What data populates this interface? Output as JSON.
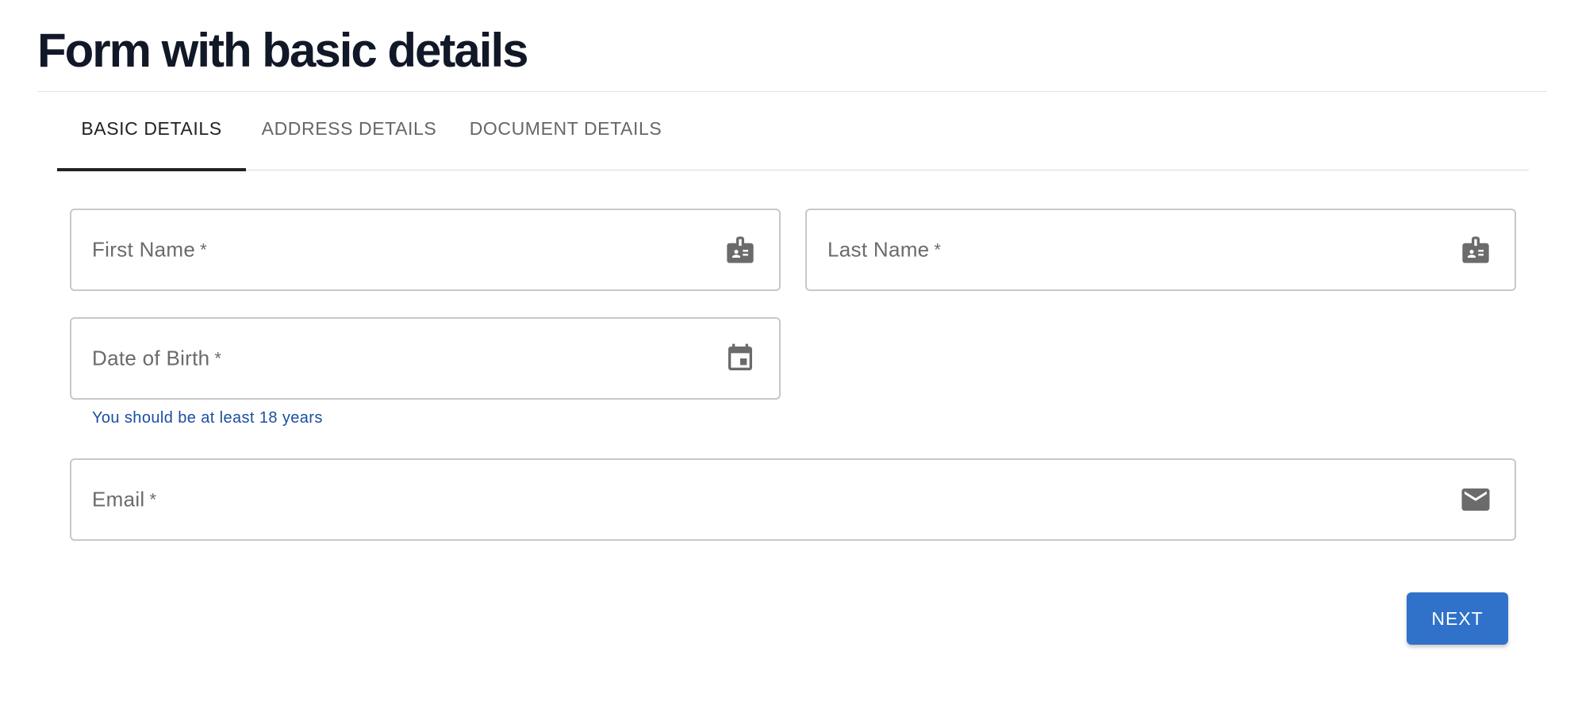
{
  "page": {
    "title": "Form with basic details"
  },
  "tabs": [
    {
      "label": "BASIC DETAILS",
      "active": true
    },
    {
      "label": "ADDRESS DETAILS",
      "active": false
    },
    {
      "label": "DOCUMENT DETAILS",
      "active": false
    }
  ],
  "form": {
    "first_name": {
      "label": "First Name",
      "required_mark": "*",
      "value": "",
      "icon": "badge-icon"
    },
    "last_name": {
      "label": "Last Name",
      "required_mark": "*",
      "value": "",
      "icon": "badge-icon"
    },
    "date_of_birth": {
      "label": "Date of Birth",
      "required_mark": "*",
      "value": "",
      "icon": "calendar-icon",
      "helper_text": "You should be at least 18 years"
    },
    "email": {
      "label": "Email",
      "required_mark": "*",
      "value": "",
      "icon": "mail-icon"
    }
  },
  "actions": {
    "next_label": "NEXT"
  },
  "colors": {
    "accent": "#3072c9",
    "helper_text": "#1a4fa0",
    "title": "#111827",
    "icon": "#6b6b6b"
  }
}
